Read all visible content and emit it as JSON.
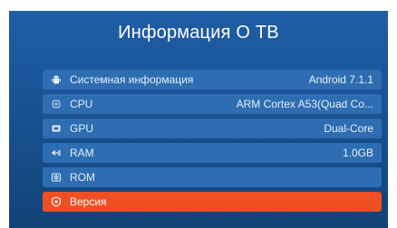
{
  "screen": {
    "title": "Информация О ТВ"
  },
  "colors": {
    "panel_bg": "#1d5aa0",
    "row_bg": "#2e6db1",
    "selected_bg": "#f04e23",
    "text": "#e6f0fb"
  },
  "items": [
    {
      "icon": "android-icon",
      "label": "Системная информация",
      "value": "Android 7.1.1",
      "selected": false
    },
    {
      "icon": "cpu-icon",
      "label": "CPU",
      "value": "ARM Cortex A53(Quad Co...",
      "selected": false
    },
    {
      "icon": "gpu-icon",
      "label": "GPU",
      "value": "Dual-Core",
      "selected": false
    },
    {
      "icon": "ram-icon",
      "label": "RAM",
      "value": "1.0GB",
      "selected": false
    },
    {
      "icon": "rom-icon",
      "label": "ROM",
      "value": "",
      "selected": false
    },
    {
      "icon": "version-icon",
      "label": "Версия",
      "value": "",
      "selected": true
    }
  ]
}
